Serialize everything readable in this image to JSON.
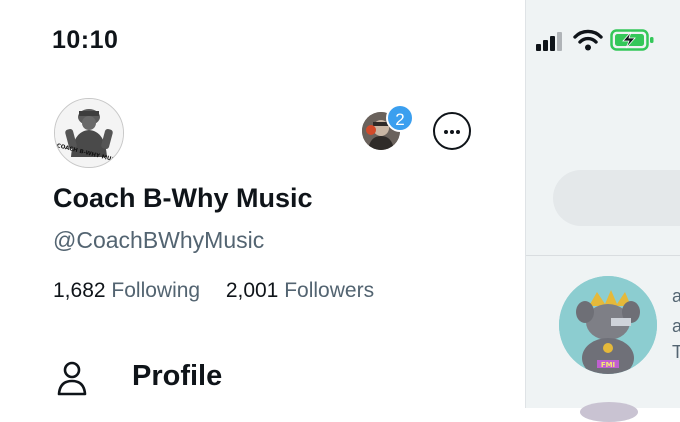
{
  "status_bar": {
    "time": "10:10"
  },
  "profile": {
    "display_name": "Coach B-Why Music",
    "handle": "@CoachBWhyMusic",
    "avatar_text": "COACH B-WHY MUSIC",
    "following_count": "1,682",
    "following_label": "Following",
    "followers_count": "2,001",
    "followers_label": "Followers"
  },
  "accounts": {
    "badge_count": "2"
  },
  "menu": {
    "items": [
      {
        "label": "Profile",
        "icon": "person-icon"
      }
    ]
  },
  "right_pane": {
    "user_avatar_text": "FMI"
  },
  "colors": {
    "text_primary": "#0f1419",
    "text_secondary": "#536471",
    "badge": "#3b9fef",
    "battery": "#34c759",
    "right_pane_bg": "#eff3f4"
  }
}
